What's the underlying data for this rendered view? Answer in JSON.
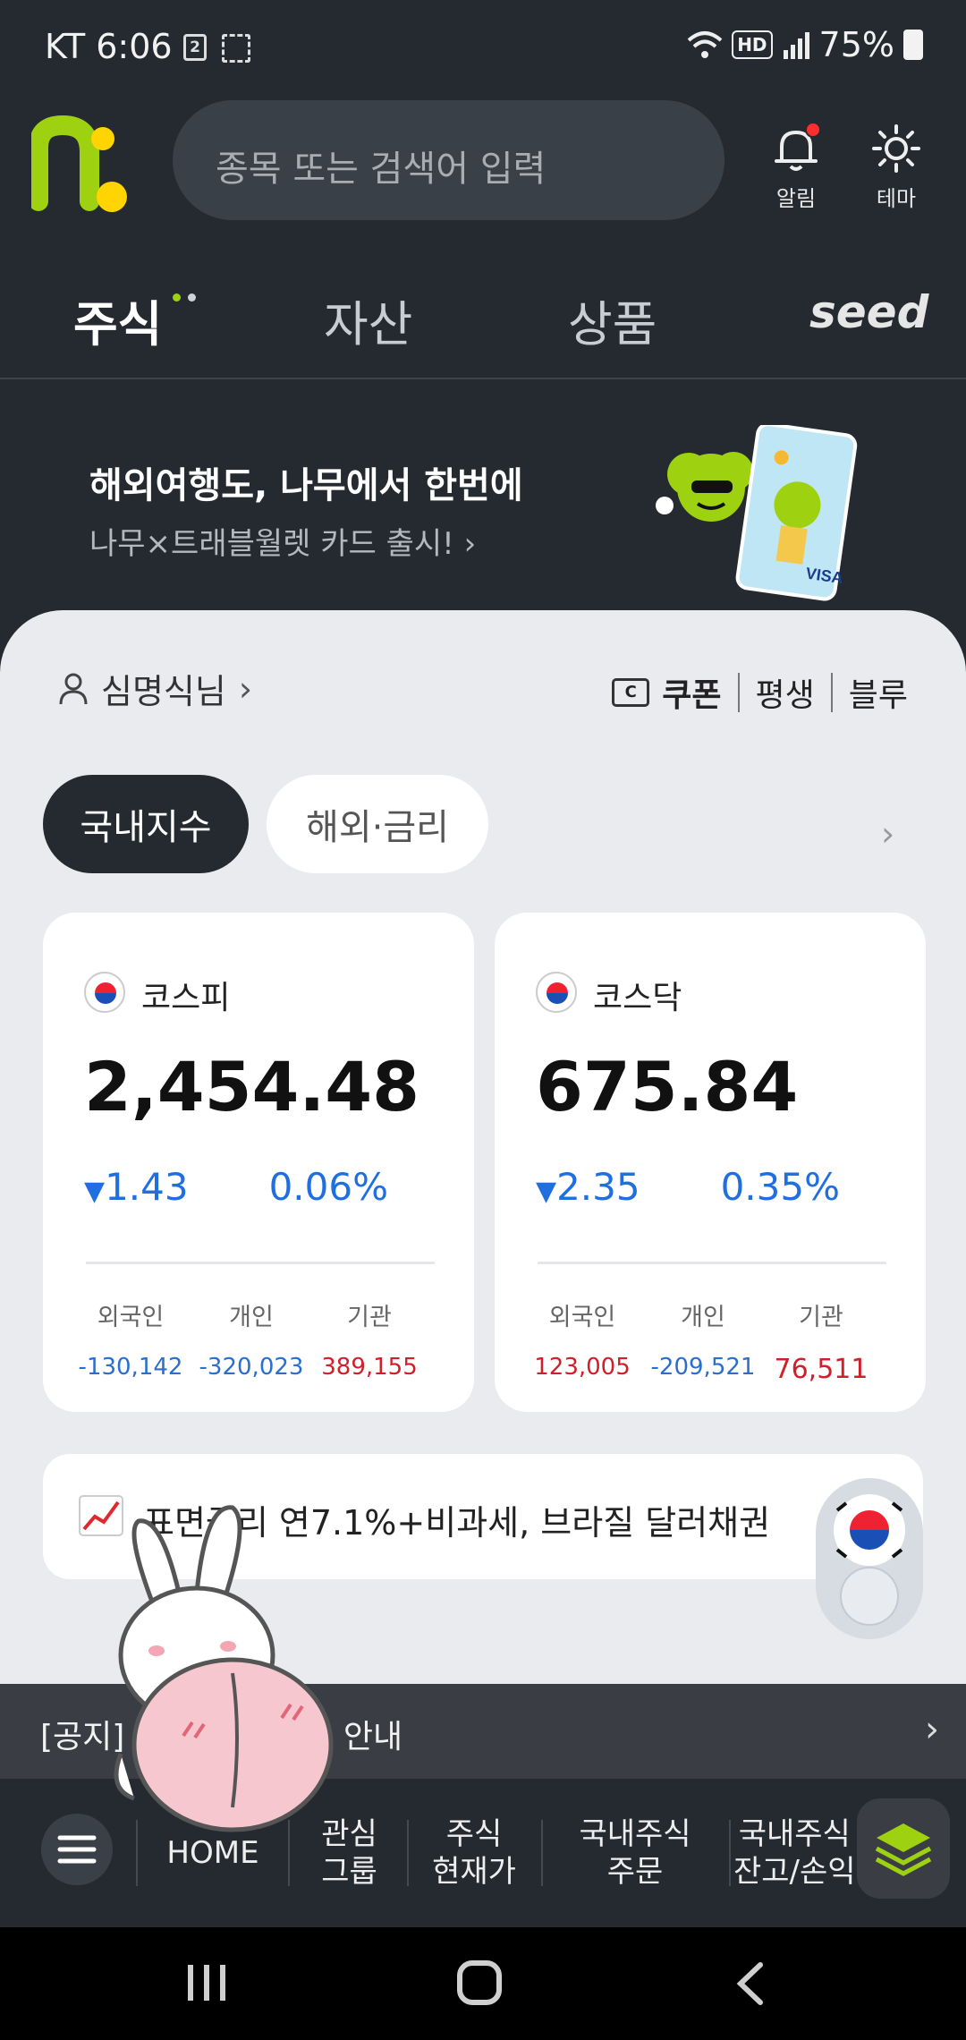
{
  "status_bar": {
    "carrier_time": "KT 6:06",
    "calendar_badge": "2",
    "hd_label": "HD",
    "battery": "75%"
  },
  "header": {
    "search_placeholder": "종목 또는 검색어 입력",
    "notifications_label": "알림",
    "theme_label": "테마"
  },
  "tabs": [
    {
      "label": "주식",
      "active": true
    },
    {
      "label": "자산",
      "active": false
    },
    {
      "label": "상품",
      "active": false
    },
    {
      "label": "seed",
      "active": false
    }
  ],
  "banner": {
    "title": "해외여행도, 나무에서 한번에",
    "subtitle": "나무×트래블월렛 카드 출시!",
    "card_brand": "VISA"
  },
  "user": {
    "name": "심명식님"
  },
  "quick_links": [
    "쿠폰",
    "평생",
    "블루"
  ],
  "segments": {
    "domestic": "국내지수",
    "global": "해외·금리"
  },
  "indices": [
    {
      "name": "코스피",
      "value": "2,454.48",
      "change": "1.43",
      "change_pct": "0.06%",
      "direction": "down",
      "investors": [
        {
          "label": "외국인",
          "value": "-130,142",
          "sign": "neg"
        },
        {
          "label": "개인",
          "value": "-320,023",
          "sign": "neg"
        },
        {
          "label": "기관",
          "value": "389,155",
          "sign": "pos"
        }
      ]
    },
    {
      "name": "코스닥",
      "value": "675.84",
      "change": "2.35",
      "change_pct": "0.35%",
      "direction": "down",
      "investors": [
        {
          "label": "외국인",
          "value": "123,005",
          "sign": "pos"
        },
        {
          "label": "개인",
          "value": "-209,521",
          "sign": "neg"
        },
        {
          "label": "기관",
          "value": "76,511",
          "sign": "pos"
        }
      ]
    }
  ],
  "promo": {
    "text": "표면금리 연7.1%+비과세, 브라질 달러채권"
  },
  "notice": {
    "text": "[공지] 공시 분류 개편 안내"
  },
  "bottom_menu": [
    {
      "label": "HOME"
    },
    {
      "label": "관심\n그룹"
    },
    {
      "label": "주식\n현재가"
    },
    {
      "label": "국내주식\n주문"
    },
    {
      "label": "국내주식\n잔고/손익"
    }
  ],
  "colors": {
    "dark_bg": "#252a30",
    "down_blue": "#1f6fe0",
    "up_red": "#d11f2a",
    "brand_green": "#9ed10f",
    "brand_yellow": "#ffd400"
  }
}
